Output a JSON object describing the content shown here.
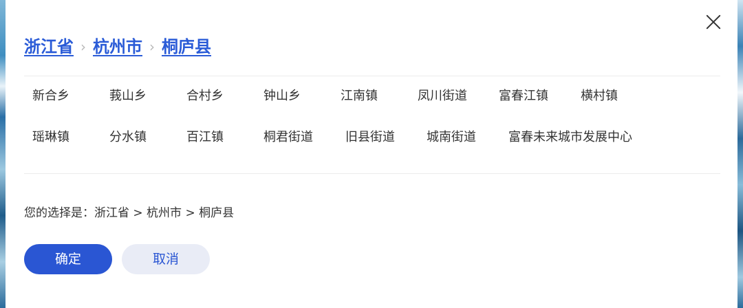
{
  "breadcrumb": {
    "items": [
      "浙江省",
      "杭州市",
      "桐庐县"
    ],
    "separator": "›"
  },
  "regions": {
    "row1": [
      "新合乡",
      "莪山乡",
      "合村乡",
      "钟山乡",
      "江南镇",
      "凤川街道",
      "富春江镇",
      "横村镇"
    ],
    "row2": [
      "瑶琳镇",
      "分水镇",
      "百江镇",
      "桐君街道",
      "旧县街道",
      "城南街道",
      "富春未来城市发展中心"
    ]
  },
  "selection": {
    "text": "您的选择是：浙江省 > 杭州市 > 桐庐县"
  },
  "buttons": {
    "confirm": "确定",
    "cancel": "取消"
  },
  "icons": {
    "close": "close-icon",
    "separator": "chevron-right-icon"
  },
  "colors": {
    "accent": "#2a56d3",
    "link": "#2a5bd7",
    "cancel_bg": "#e9ecf6"
  }
}
